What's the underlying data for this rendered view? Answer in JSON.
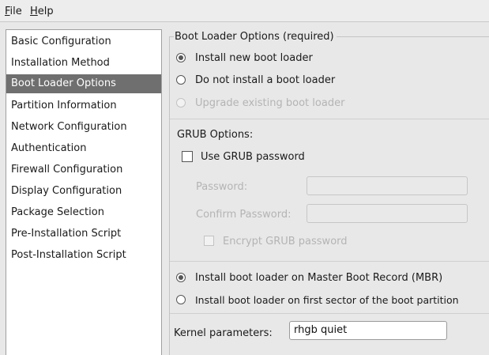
{
  "menubar": {
    "items": [
      {
        "mnemonic": "F",
        "rest": "ile"
      },
      {
        "mnemonic": "H",
        "rest": "elp"
      }
    ]
  },
  "sidebar": {
    "items": [
      {
        "label": "Basic Configuration"
      },
      {
        "label": "Installation Method"
      },
      {
        "label": "Boot Loader Options",
        "selected": true
      },
      {
        "label": "Partition Information"
      },
      {
        "label": "Network Configuration"
      },
      {
        "label": "Authentication"
      },
      {
        "label": "Firewall Configuration"
      },
      {
        "label": "Display Configuration"
      },
      {
        "label": "Package Selection"
      },
      {
        "label": "Pre-Installation Script"
      },
      {
        "label": "Post-Installation Script"
      }
    ]
  },
  "boot_loader": {
    "group_title": "Boot Loader Options (required)",
    "install_choice": {
      "options": [
        {
          "label": "Install new boot loader",
          "checked": true,
          "enabled": true
        },
        {
          "label": "Do not install a boot loader",
          "checked": false,
          "enabled": true
        },
        {
          "label": "Upgrade existing boot loader",
          "checked": false,
          "enabled": false
        }
      ]
    },
    "grub": {
      "heading": "GRUB Options:",
      "use_password_label": "Use GRUB password",
      "use_password_checked": false,
      "password_label": "Password:",
      "password_value": "",
      "confirm_label": "Confirm Password:",
      "confirm_value": "",
      "encrypt_label": "Encrypt GRUB password",
      "encrypt_checked": false
    },
    "location": {
      "options": [
        {
          "label": "Install boot loader on Master Boot Record (MBR)",
          "checked": true
        },
        {
          "label": "Install boot loader on first sector of the boot partition",
          "checked": false
        }
      ]
    },
    "kernel": {
      "label": "Kernel parameters:",
      "value": "rhgb quiet"
    }
  }
}
